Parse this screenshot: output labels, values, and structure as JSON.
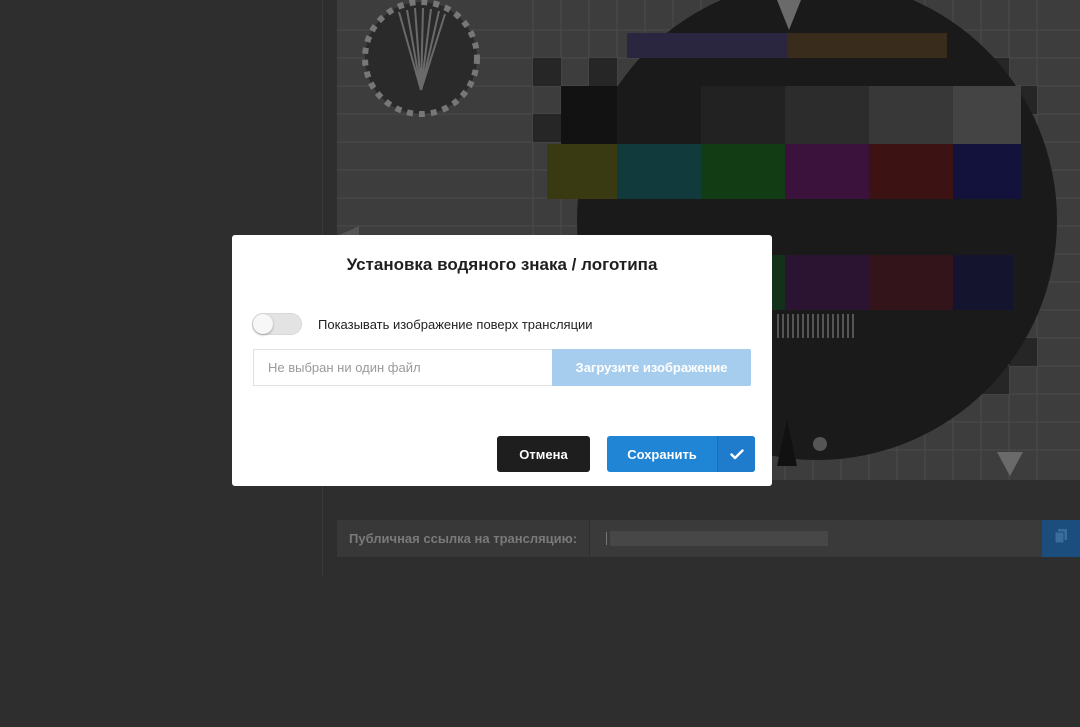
{
  "background": {
    "public_link_label": "Публичная ссылка на трансляцию:"
  },
  "modal": {
    "title": "Установка водяного знака / логотипа",
    "toggle_label": "Показывать изображение поверх трансляции",
    "toggle_on": false,
    "file_input_placeholder": "Не выбран ни один файл",
    "upload_button": "Загрузите изображение",
    "cancel_button": "Отмена",
    "save_button": "Сохранить"
  },
  "icons": {
    "save_icon": "checkmark-icon",
    "copy_icon": "copy-icon"
  },
  "colors": {
    "primary": "#2185d6",
    "upload_disabled": "#a7cdee",
    "cancel": "#1e1e1e"
  }
}
